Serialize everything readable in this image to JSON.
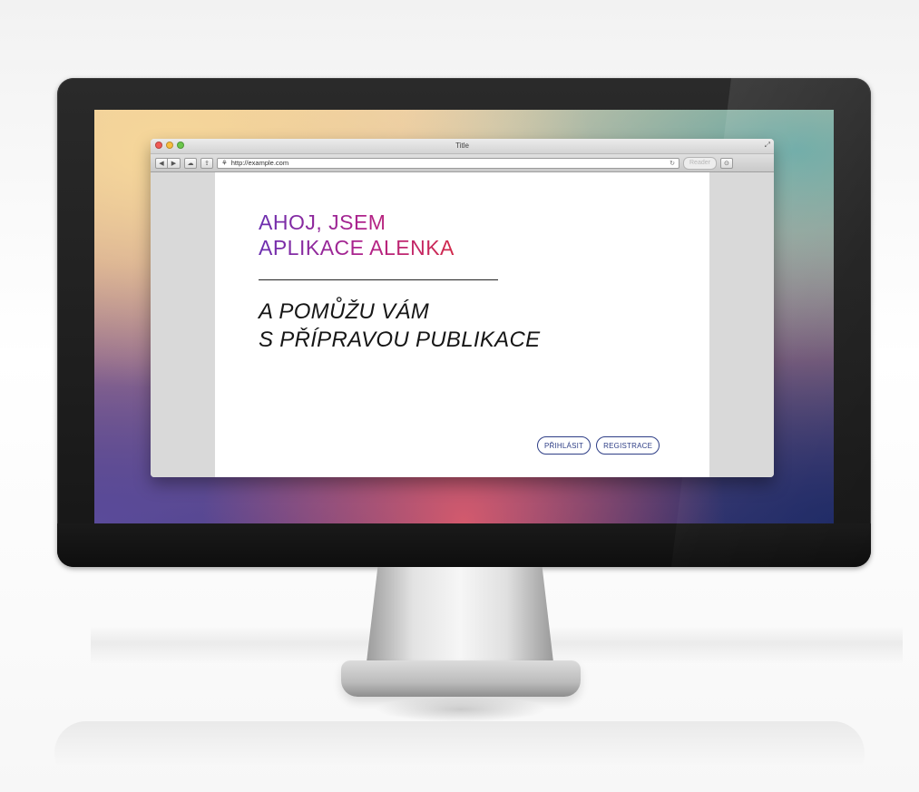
{
  "browser": {
    "window_title": "Title",
    "address_url": "http://example.com",
    "reader_label": "Reader"
  },
  "page": {
    "heading_lines": [
      "AHOJ, JSEM",
      "APLIKACE ALENKA"
    ],
    "subtitle_lines": [
      "A POMŮŽU VÁM",
      "S PŘÍPRAVOU PUBLIKACE"
    ],
    "buttons": {
      "login": "PŘIHLÁSIT",
      "register": "REGISTRACE"
    }
  },
  "colors": {
    "heading_gradient": [
      "#6b2fb0",
      "#b1228a",
      "#d12a4a"
    ],
    "button_border": "#2e3e86"
  },
  "icons": [
    "back-icon",
    "forward-icon",
    "cloud-icon",
    "share-icon",
    "compass-icon",
    "reload-icon",
    "download-icon",
    "fullscreen-icon"
  ]
}
